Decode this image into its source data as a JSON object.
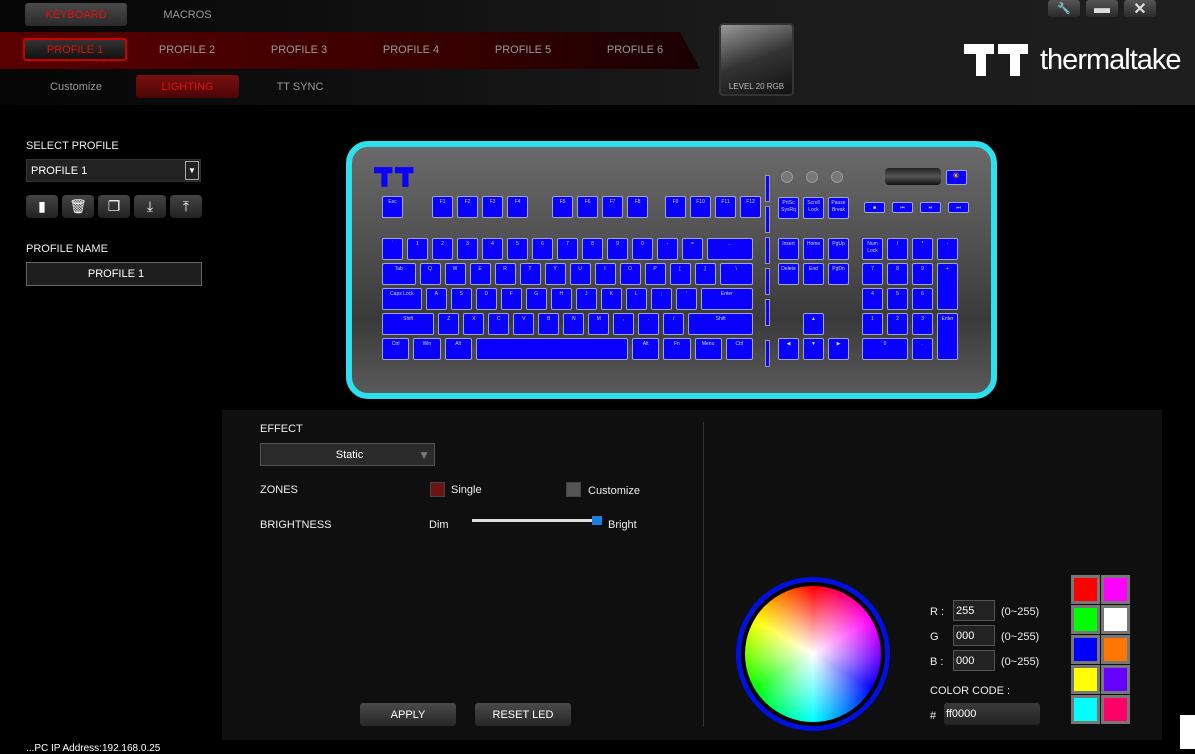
{
  "top_tabs": [
    {
      "label": "KEYBOARD",
      "active": true
    },
    {
      "label": "MACROS",
      "active": false
    }
  ],
  "profile_tabs": [
    "PROFILE 1",
    "PROFILE 2",
    "PROFILE 3",
    "PROFILE 4",
    "PROFILE 5",
    "PROFILE 6"
  ],
  "sub_tabs": [
    "Customize",
    "LIGHTING",
    "TT SYNC"
  ],
  "device": {
    "name": "LEVEL 20 RGB"
  },
  "brand": "thermaltake",
  "window_controls": [
    "wrench-icon",
    "minimize-icon",
    "close-icon"
  ],
  "sidebar": {
    "select_label": "SELECT PROFILE",
    "selected_profile": "PROFILE 1",
    "buttons": [
      "new-profile",
      "delete-profile",
      "copy-profile",
      "import-profile",
      "export-profile"
    ],
    "name_label": "PROFILE NAME",
    "name_value": "PROFILE 1"
  },
  "keyboard": {
    "frow": [
      "Esc",
      "F1",
      "F2",
      "F3",
      "F4",
      "F5",
      "F6",
      "F7",
      "F8",
      "F9",
      "F10",
      "F11",
      "F12"
    ],
    "rows": [
      [
        "`",
        "1",
        "2",
        "3",
        "4",
        "5",
        "6",
        "7",
        "8",
        "9",
        "0",
        "-",
        "=",
        "←"
      ],
      [
        "Tab",
        "Q",
        "W",
        "E",
        "R",
        "T",
        "Y",
        "U",
        "I",
        "O",
        "P",
        "[",
        "]",
        "\\"
      ],
      [
        "Caps Lock",
        "A",
        "S",
        "D",
        "F",
        "G",
        "H",
        "J",
        "K",
        "L",
        ";",
        "'",
        "Enter"
      ],
      [
        "Shift",
        "Z",
        "X",
        "C",
        "V",
        "B",
        "N",
        "M",
        ",",
        ".",
        "/",
        "Shift"
      ],
      [
        "Ctrl",
        "Win",
        "Alt",
        "",
        "Alt",
        "Fn",
        "Menu",
        "Ctrl"
      ]
    ],
    "sys": [
      "PrtSc SysRq",
      "Scroll Lock",
      "Pause Break"
    ],
    "media": [
      "■",
      "⏮",
      "⏯",
      "⏭"
    ],
    "nav": [
      [
        "Insert",
        "Home",
        "PgUp"
      ],
      [
        "Delete",
        "End",
        "PgDn"
      ]
    ],
    "arrows": [
      "▲",
      "◀",
      "▼",
      "▶"
    ],
    "numpad": [
      "Num Lock",
      "/",
      "*",
      "-",
      "7",
      "8",
      "9",
      "+",
      "4",
      "5",
      "6",
      "1",
      "2",
      "3",
      "Enter",
      "0",
      "."
    ],
    "key_color": "#0a00ff",
    "edge_color": "#2de0ee"
  },
  "lighting": {
    "effect_label": "EFFECT",
    "effect_value": "Static",
    "zones_label": "ZONES",
    "zone_options": [
      "Single",
      "Customize"
    ],
    "zone_selected": "Single",
    "brightness_label": "BRIGHTNESS",
    "dim_label": "Dim",
    "bright_label": "Bright",
    "brightness": 100,
    "apply": "APPLY",
    "reset": "RESET LED"
  },
  "color": {
    "r_label": "R :",
    "g_label": "G",
    "b_label": "B :",
    "r": "255",
    "g": "000",
    "b": "000",
    "range": "(0~255)",
    "code_label": "COLOR CODE :",
    "hash": "#",
    "code": "ff0000",
    "swatches": [
      "#ff0000",
      "#ff00ff",
      "#00ff00",
      "#ffffff",
      "#0000ff",
      "#ff7700",
      "#ffff00",
      "#6600ff",
      "#00ffff",
      "#ff0066"
    ]
  },
  "footer": {
    "text": "...PC IP Address:192.168.0.25"
  }
}
